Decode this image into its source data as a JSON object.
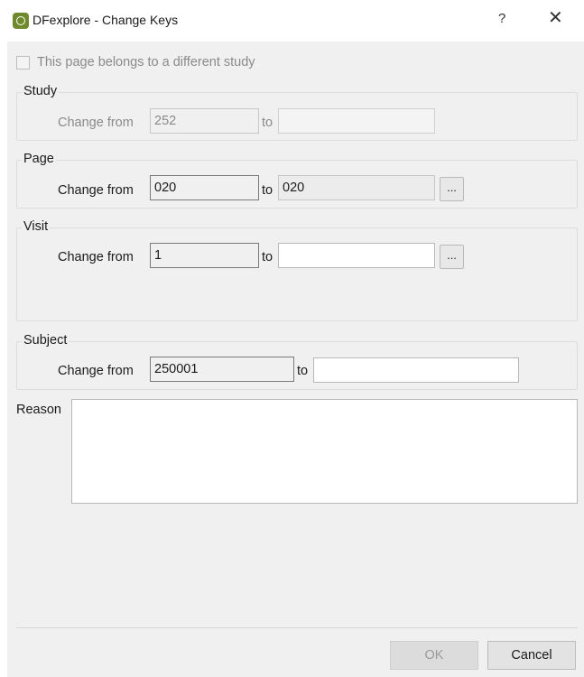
{
  "window": {
    "title": "DFexplore - Change Keys",
    "help_label": "?",
    "close_label": "✕",
    "icon": "dfexplore-app-icon"
  },
  "different_study": {
    "label": "This page belongs to a different study",
    "checked": false,
    "enabled": false
  },
  "study": {
    "group_title": "Study",
    "change_from_label": "Change from",
    "from_value": "252",
    "to_label": "to",
    "to_value": ""
  },
  "page": {
    "group_title": "Page",
    "change_from_label": "Change from",
    "from_value": "020",
    "to_label": "to",
    "to_value": "020",
    "browse_label": "..."
  },
  "visit": {
    "group_title": "Visit",
    "change_from_label": "Change from",
    "from_value": "1",
    "to_label": "to",
    "to_value": "",
    "browse_label": "..."
  },
  "subject": {
    "group_title": "Subject",
    "change_from_label": "Change from",
    "from_value": "250001",
    "to_label": "to",
    "to_value": ""
  },
  "reason": {
    "label": "Reason",
    "value": ""
  },
  "buttons": {
    "ok_label": "OK",
    "ok_enabled": false,
    "cancel_label": "Cancel"
  }
}
